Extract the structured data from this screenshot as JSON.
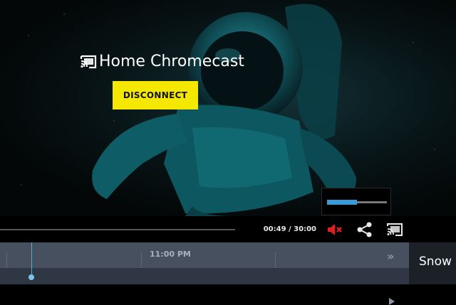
{
  "cast": {
    "device_name": "Home Chromecast",
    "cast_icon": "cast-connected-icon",
    "disconnect_label": "DISCONNECT"
  },
  "volume": {
    "level": 0.5,
    "muted": true,
    "accent_color": "#3b9ad8"
  },
  "player": {
    "time_display": "00:49 / 30:00",
    "icons": [
      "mute-icon",
      "share-icon",
      "cast-icon"
    ]
  },
  "guide": {
    "time_marker": "11:00 PM",
    "next_icon": "double-chevron-right-icon",
    "play_icon": "play-icon"
  },
  "channel": {
    "name": "Snow"
  },
  "colors": {
    "disconnect_button": "#f5e800",
    "mute_icon": "#e02020",
    "guide_background": "#47505e",
    "playhead": "#4fb0d6"
  }
}
